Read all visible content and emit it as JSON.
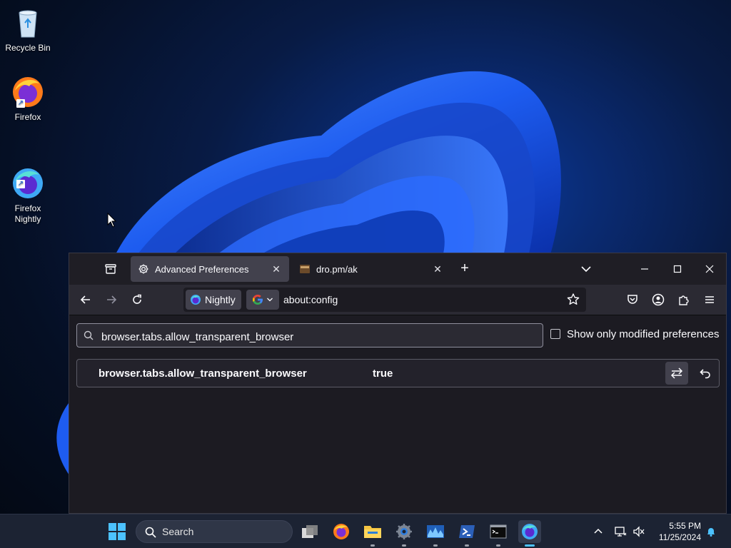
{
  "desktop": {
    "icons": [
      {
        "label": "Recycle Bin"
      },
      {
        "label": "Firefox"
      },
      {
        "label": "Firefox\nNightly"
      }
    ]
  },
  "browser": {
    "tabs": [
      {
        "label": "Advanced Preferences",
        "icon": "gear-icon",
        "active": true
      },
      {
        "label": "dro.pm/ak",
        "icon": "site-favicon",
        "active": false
      }
    ],
    "identity_label": "Nightly",
    "url": "about:config"
  },
  "config": {
    "search_value": "browser.tabs.allow_transparent_browser",
    "modified_only_label": "Show only modified preferences",
    "modified_only_checked": false,
    "prefs": [
      {
        "name": "browser.tabs.allow_transparent_browser",
        "value": "true"
      }
    ]
  },
  "taskbar": {
    "search_label": "Search",
    "time": "5:55 PM",
    "date": "11/25/2024"
  },
  "colors": {
    "accent": "#4cc2ff",
    "window_bg": "#1c1b22",
    "toolbar_bg": "#2b2a33"
  }
}
